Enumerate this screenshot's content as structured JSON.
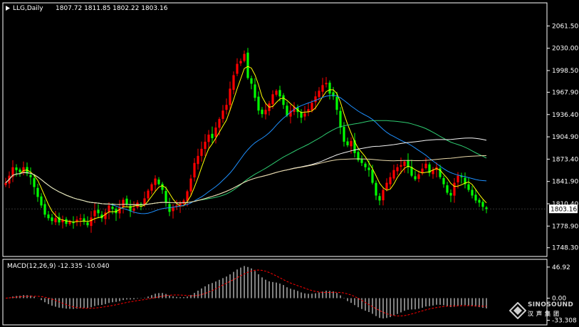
{
  "header": {
    "symbol": "LLG,Daily",
    "ohlc": "1807.72 1811.85 1802.22 1803.16"
  },
  "macd": {
    "label": "MACD(12,26,9) -12.335 -10.040",
    "axis_labels": [
      "46.92",
      "0.00",
      "-33.308"
    ]
  },
  "current_price": "1803.16",
  "watermark": {
    "brand": "SINOSOUND",
    "sub": "汉声集团"
  },
  "colors": {
    "up": "#ff0000",
    "down": "#00ff00",
    "ma_yellow": "#ffff00",
    "ma_blue": "#1e90ff",
    "ma_green": "#2ecc71",
    "ma_white": "#f5f5f5",
    "ma_tan": "#e8d8a8",
    "macd_hist": "#ffffff",
    "macd_signal": "#ff0000",
    "price_tag_bg": "#ffffff",
    "price_tag_fg": "#000000"
  },
  "chart_data": [
    {
      "type": "candlestick",
      "title": "LLG,Daily",
      "y_ticks": [
        2061.5,
        2030.0,
        1998.5,
        1967.9,
        1936.4,
        1904.9,
        1873.4,
        1841.9,
        1810.4,
        1778.9,
        1748.3
      ],
      "y_tick_labels": [
        "2061.50",
        "2030.00",
        "1998.50",
        "1967.90",
        "1936.40",
        "1904.90",
        "1873.40",
        "1841.90",
        "1810.40",
        "1778.90",
        "1748.30"
      ],
      "ylim": [
        1744,
        2076
      ],
      "grid": false,
      "closes": [
        1840,
        1850,
        1862,
        1858,
        1855,
        1862,
        1853,
        1848,
        1834,
        1820,
        1808,
        1795,
        1790,
        1786,
        1790,
        1784,
        1788,
        1782,
        1785,
        1783,
        1788,
        1790,
        1785,
        1780,
        1791,
        1801,
        1797,
        1790,
        1798,
        1808,
        1803,
        1797,
        1806,
        1816,
        1809,
        1800,
        1804,
        1812,
        1808,
        1818,
        1829,
        1838,
        1846,
        1838,
        1830,
        1812,
        1799,
        1805,
        1808,
        1812,
        1815,
        1828,
        1846,
        1868,
        1878,
        1888,
        1898,
        1908,
        1903,
        1918,
        1930,
        1942,
        1950,
        1973,
        1992,
        2008,
        2012,
        2022,
        1988,
        1980,
        1960,
        1942,
        1937,
        1943,
        1952,
        1965,
        1970,
        1962,
        1950,
        1935,
        1942,
        1947,
        1940,
        1932,
        1938,
        1944,
        1953,
        1962,
        1970,
        1978,
        1981,
        1966,
        1962,
        1943,
        1918,
        1898,
        1893,
        1899,
        1882,
        1872,
        1868,
        1862,
        1858,
        1840,
        1822,
        1815,
        1830,
        1840,
        1848,
        1858,
        1862,
        1865,
        1870,
        1862,
        1850,
        1845,
        1852,
        1860,
        1867,
        1854,
        1858,
        1862,
        1848,
        1838,
        1826,
        1822,
        1840,
        1850,
        1848,
        1838,
        1830,
        1822,
        1815,
        1812,
        1806,
        1803
      ],
      "current": 1803.16
    },
    {
      "type": "bar",
      "title": "MACD(12,26,9) -12.335 -10.040",
      "signal_value": -10.04,
      "macd_value": -12.335,
      "y_ticks": [
        46.92,
        0.0,
        -33.308
      ],
      "ylim": [
        -36,
        50
      ]
    }
  ]
}
